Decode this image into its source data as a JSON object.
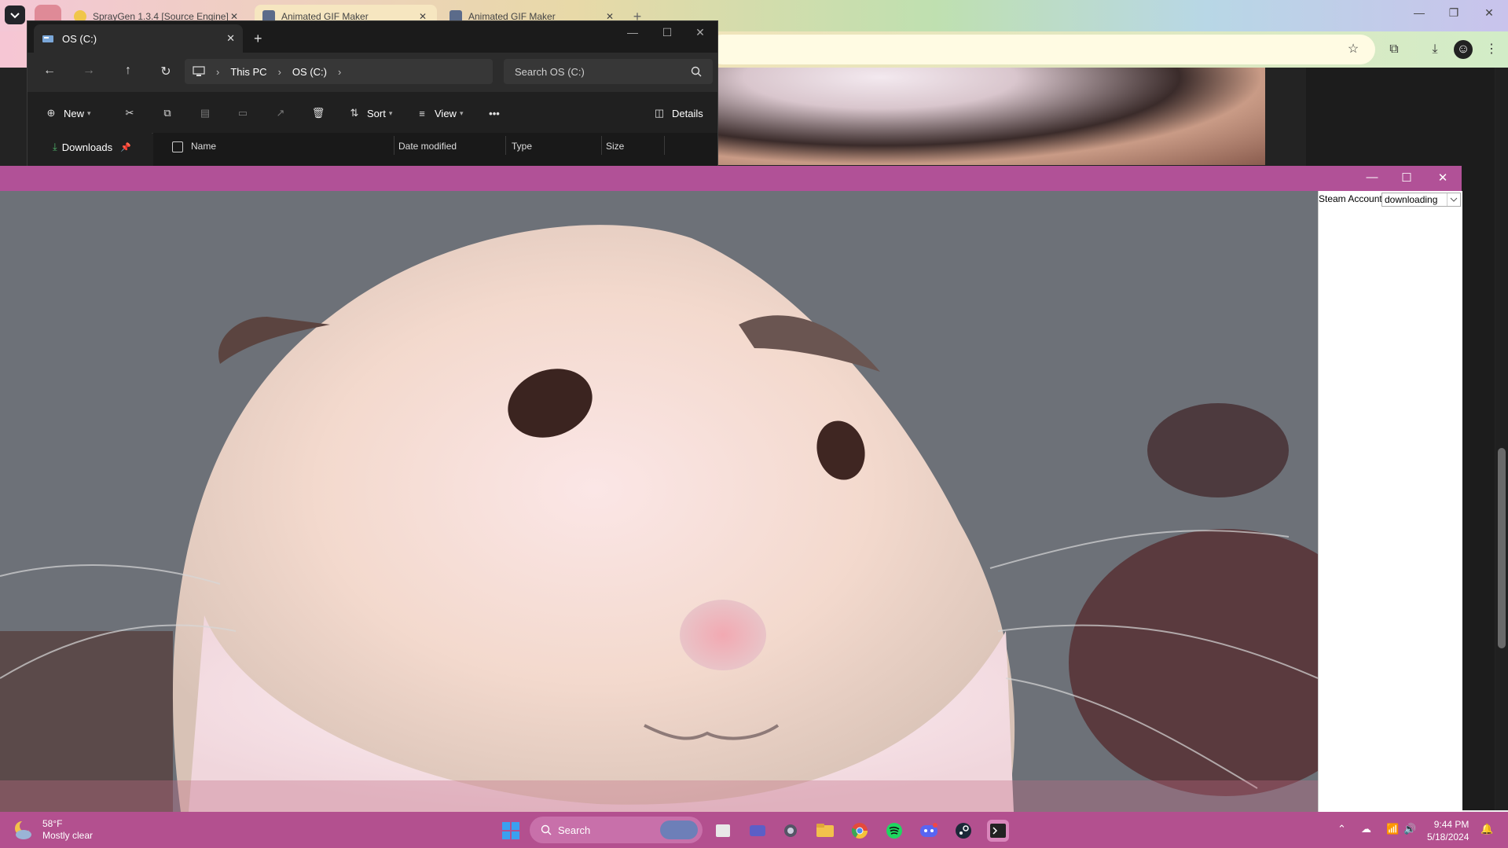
{
  "browser": {
    "tabs": [
      {
        "label": "SprayGen 1.3.4 [Source Engine]",
        "active": false
      },
      {
        "label": "Animated GIF Maker",
        "active": true
      },
      {
        "label": "Animated GIF Maker",
        "active": false
      }
    ],
    "toolbar_icons": [
      "star-icon",
      "extensions-icon",
      "download-icon",
      "profile-icon",
      "menu-icon"
    ]
  },
  "explorer": {
    "tab_title": "OS (C:)",
    "breadcrumb": [
      "This PC",
      "OS (C:)"
    ],
    "search_placeholder": "Search OS (C:)",
    "commands": {
      "new": "New",
      "sort": "Sort",
      "view": "View",
      "details": "Details"
    },
    "nav_items": [
      {
        "label": "Downloads",
        "pinned": true
      }
    ],
    "columns": [
      "Name",
      "Date modified",
      "Type",
      "Size"
    ]
  },
  "gif_maker": {
    "side_label": "Steam Account",
    "select_value": "downloading"
  },
  "taskbar": {
    "weather_temp": "58°F",
    "weather_desc": "Mostly clear",
    "search_placeholder": "Search",
    "time": "9:44 PM",
    "date": "5/18/2024"
  },
  "colors": {
    "gif_titlebar": "#b15197",
    "taskbar": "#b3508f",
    "explorer_bg": "#202020"
  }
}
